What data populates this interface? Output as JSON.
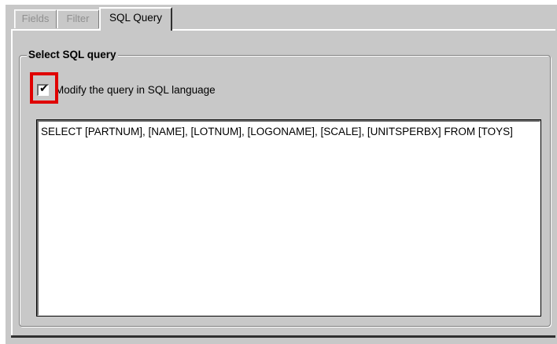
{
  "tabs": [
    {
      "label": "Fields",
      "active": false
    },
    {
      "label": "Filter",
      "active": false
    },
    {
      "label": "SQL Query",
      "active": true
    }
  ],
  "group": {
    "title": "Select SQL query"
  },
  "modify_checkbox": {
    "label": "Modify the query in SQL language",
    "checked": true,
    "highlight_color": "#e00000"
  },
  "sql_query": {
    "value": "SELECT [PARTNUM], [NAME], [LOTNUM], [LOGONAME], [SCALE], [UNITSPERBX] FROM [TOYS]"
  },
  "colors": {
    "dialog_background": "#c8c8c8",
    "inactive_tab_text": "#909090"
  }
}
